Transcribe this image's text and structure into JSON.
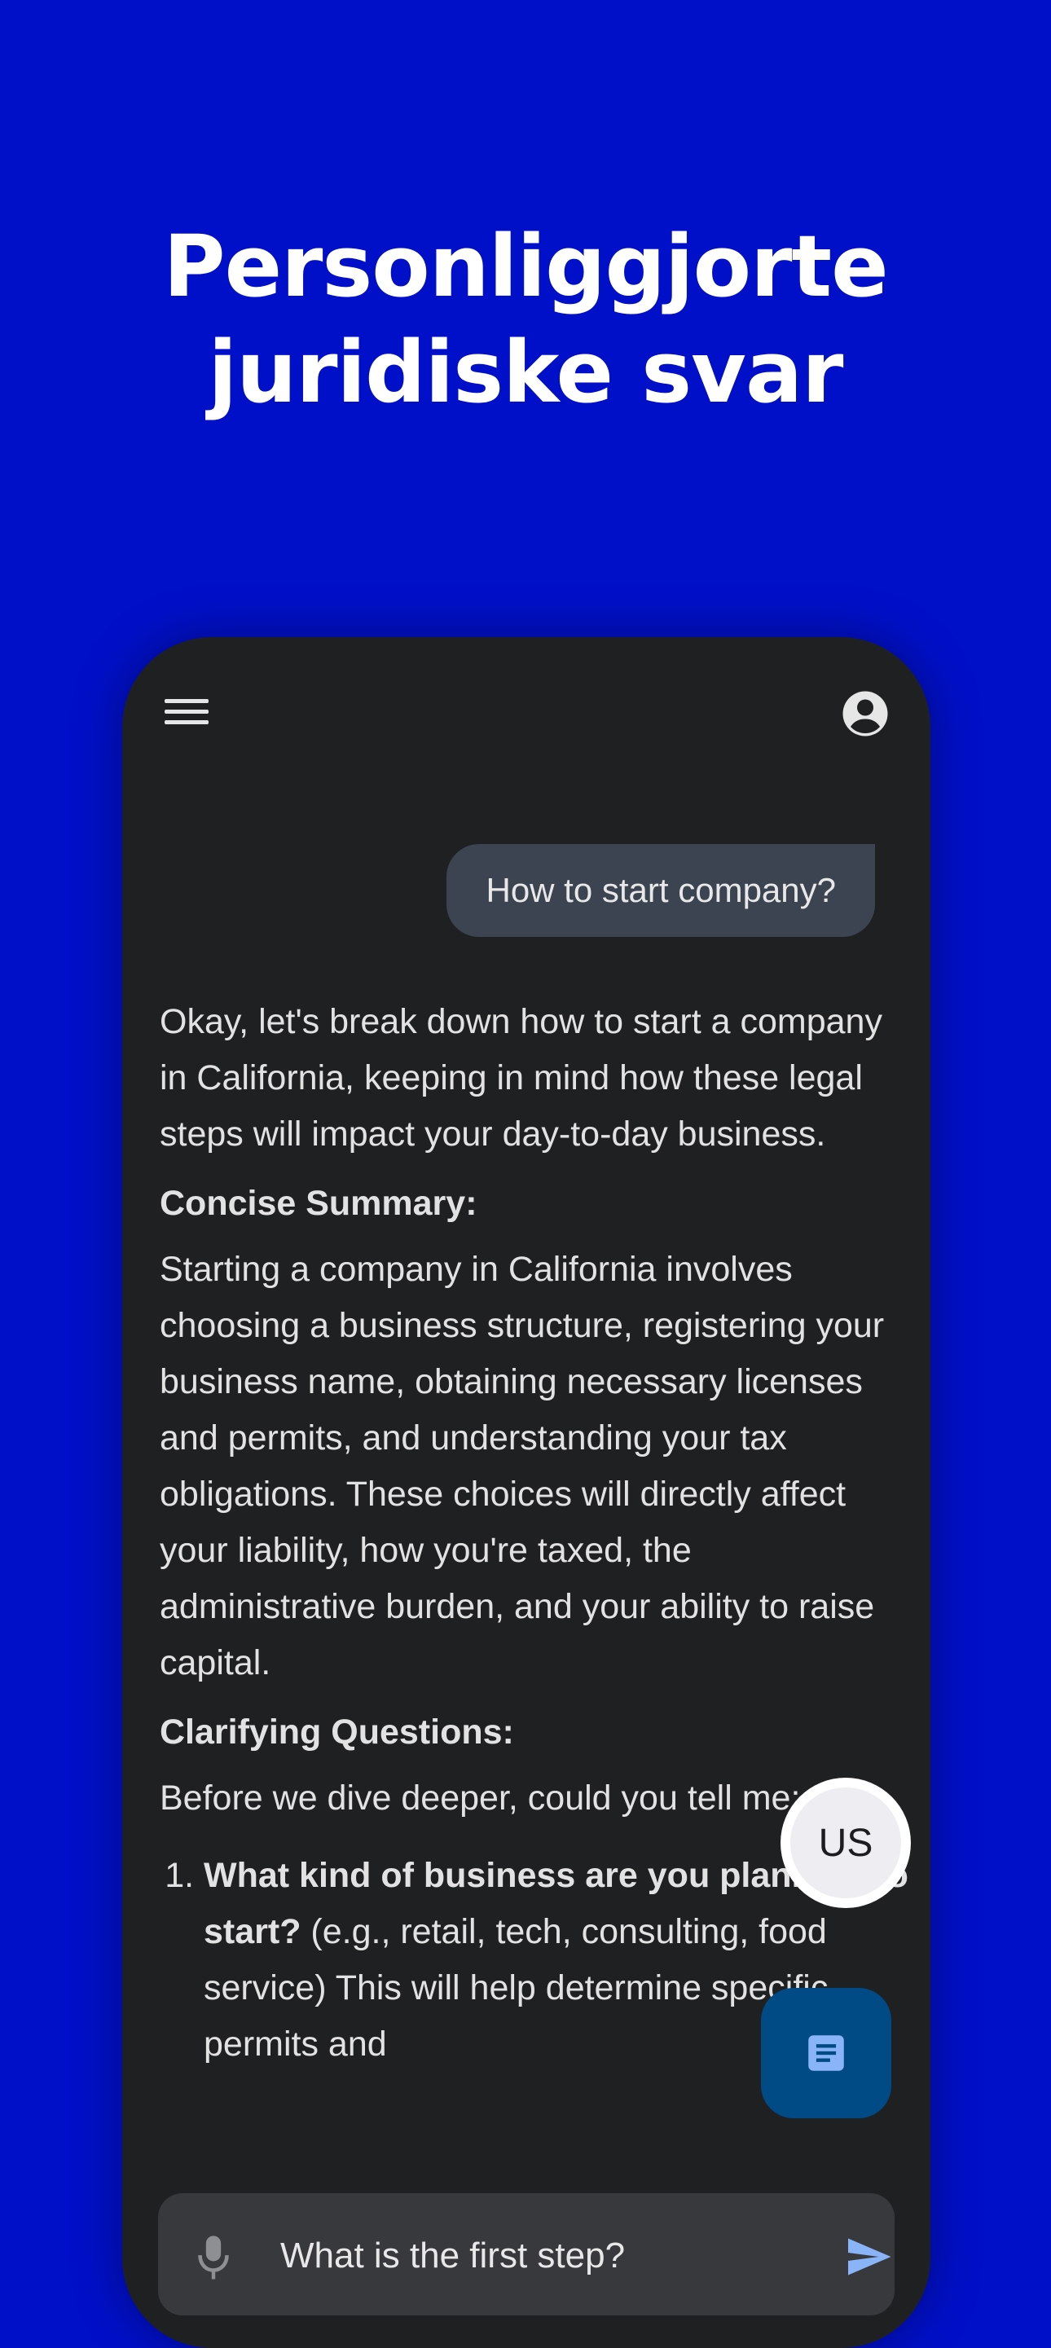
{
  "headline": {
    "line1": "Personliggjorte",
    "line2": "juridiske svar"
  },
  "colors": {
    "background": "#0010c8",
    "phone_surface": "#1f2021",
    "user_bubble": "#3b4450",
    "doc_fab": "#004a86",
    "send_icon": "#8ab4f8"
  },
  "icons": {
    "menu": "hamburger-menu-icon",
    "account": "account-circle-icon",
    "document": "document-icon",
    "mic": "microphone-icon",
    "send": "send-icon"
  },
  "chat": {
    "user_message": "How to start company?",
    "intro": "Okay, let's break down how to start a company in California, keeping in mind how these legal steps will impact your day-to-day business.",
    "summary_heading": "Concise Summary:",
    "summary_text": "Starting a company in California involves choosing a business structure, registering your business name, obtaining necessary licenses and permits, and understanding your tax obligations. These choices will directly affect your liability, how you're taxed, the administrative burden, and your ability to raise capital.",
    "questions_heading": "Clarifying Questions:",
    "questions_intro": "Before we dive deeper, could you tell me:",
    "questions": [
      {
        "bold": "What kind of business are you planning to start?",
        "text": " (e.g., retail, tech, consulting, food service) This will help determine specific permits and"
      }
    ]
  },
  "fab": {
    "region_label": "US"
  },
  "input": {
    "value": "What is the first step?"
  }
}
